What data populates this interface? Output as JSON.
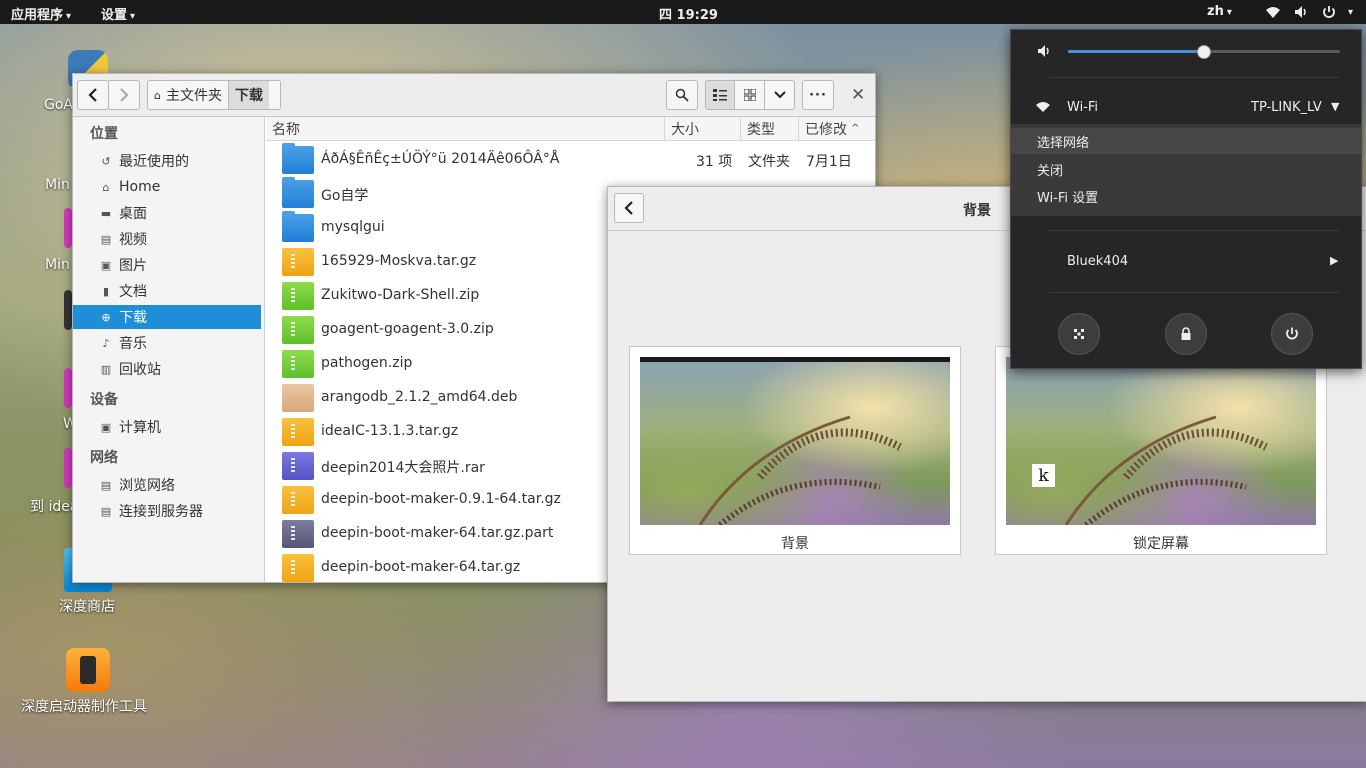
{
  "top_panel": {
    "apps_menu": "应用程序",
    "settings_menu": "设置",
    "clock": "四 19:29",
    "input_method": "zh"
  },
  "desktop": {
    "icons": [
      {
        "label": "GoA"
      },
      {
        "label": "Min"
      },
      {
        "label": "Min"
      },
      {
        "label": "W"
      },
      {
        "label": "到 idea"
      },
      {
        "label": "深度商店"
      },
      {
        "label": "深度启动器制作工具"
      }
    ]
  },
  "file_manager": {
    "breadcrumbs": [
      "主文件夹",
      "下载"
    ],
    "sidebar": {
      "places_header": "位置",
      "places": [
        "最近使用的",
        "Home",
        "桌面",
        "视频",
        "图片",
        "文档",
        "下载",
        "音乐",
        "回收站"
      ],
      "devices_header": "设备",
      "devices": [
        "计算机"
      ],
      "network_header": "网络",
      "network": [
        "浏览网络",
        "连接到服务器"
      ]
    },
    "columns": {
      "name": "名称",
      "size": "大小",
      "type": "类型",
      "modified": "已修改"
    },
    "files": [
      {
        "name": "ÁðÁ§ÊñÊç±ÚÖÝ°ü 2014Äê06ÔÂ°Å",
        "size": "31 项",
        "type": "文件夹",
        "modified": "7月1日",
        "kind": "folder"
      },
      {
        "name": "Go自学",
        "size": "",
        "type": "",
        "modified": "",
        "kind": "folder"
      },
      {
        "name": "mysqlgui",
        "size": "",
        "type": "",
        "modified": "",
        "kind": "folder"
      },
      {
        "name": "165929-Moskva.tar.gz",
        "size": "",
        "type": "",
        "modified": "",
        "kind": "archive"
      },
      {
        "name": "Zukitwo-Dark-Shell.zip",
        "size": "",
        "type": "",
        "modified": "",
        "kind": "zip"
      },
      {
        "name": "goagent-goagent-3.0.zip",
        "size": "",
        "type": "",
        "modified": "",
        "kind": "zip"
      },
      {
        "name": "pathogen.zip",
        "size": "",
        "type": "",
        "modified": "",
        "kind": "zip"
      },
      {
        "name": "arangodb_2.1.2_amd64.deb",
        "size": "",
        "type": "",
        "modified": "",
        "kind": "deb"
      },
      {
        "name": "ideaIC-13.1.3.tar.gz",
        "size": "",
        "type": "",
        "modified": "",
        "kind": "archive"
      },
      {
        "name": "deepin2014大会照片.rar",
        "size": "",
        "type": "",
        "modified": "",
        "kind": "rar"
      },
      {
        "name": "deepin-boot-maker-0.9.1-64.tar.gz",
        "size": "",
        "type": "",
        "modified": "",
        "kind": "archive"
      },
      {
        "name": "deepin-boot-maker-64.tar.gz.part",
        "size": "",
        "type": "",
        "modified": "",
        "kind": "part"
      },
      {
        "name": "deepin-boot-maker-64.tar.gz",
        "size": "",
        "type": "",
        "modified": "",
        "kind": "archive"
      }
    ]
  },
  "background_window": {
    "title": "背景",
    "cards": [
      {
        "label": "背景"
      },
      {
        "label": "锁定屏幕"
      }
    ]
  },
  "system_menu": {
    "volume_level": 0.5,
    "wifi_label": "Wi-Fi",
    "wifi_network": "TP-LINK_LV",
    "wifi_submenu": [
      "选择网络",
      "关闭",
      "Wi-Fi 设置"
    ],
    "user_name": "Bluek404",
    "user_avatar_letter": "k"
  },
  "colors": {
    "accent": "#1e8fd6",
    "panel": "#1a1a1a",
    "popover": "#262626"
  }
}
